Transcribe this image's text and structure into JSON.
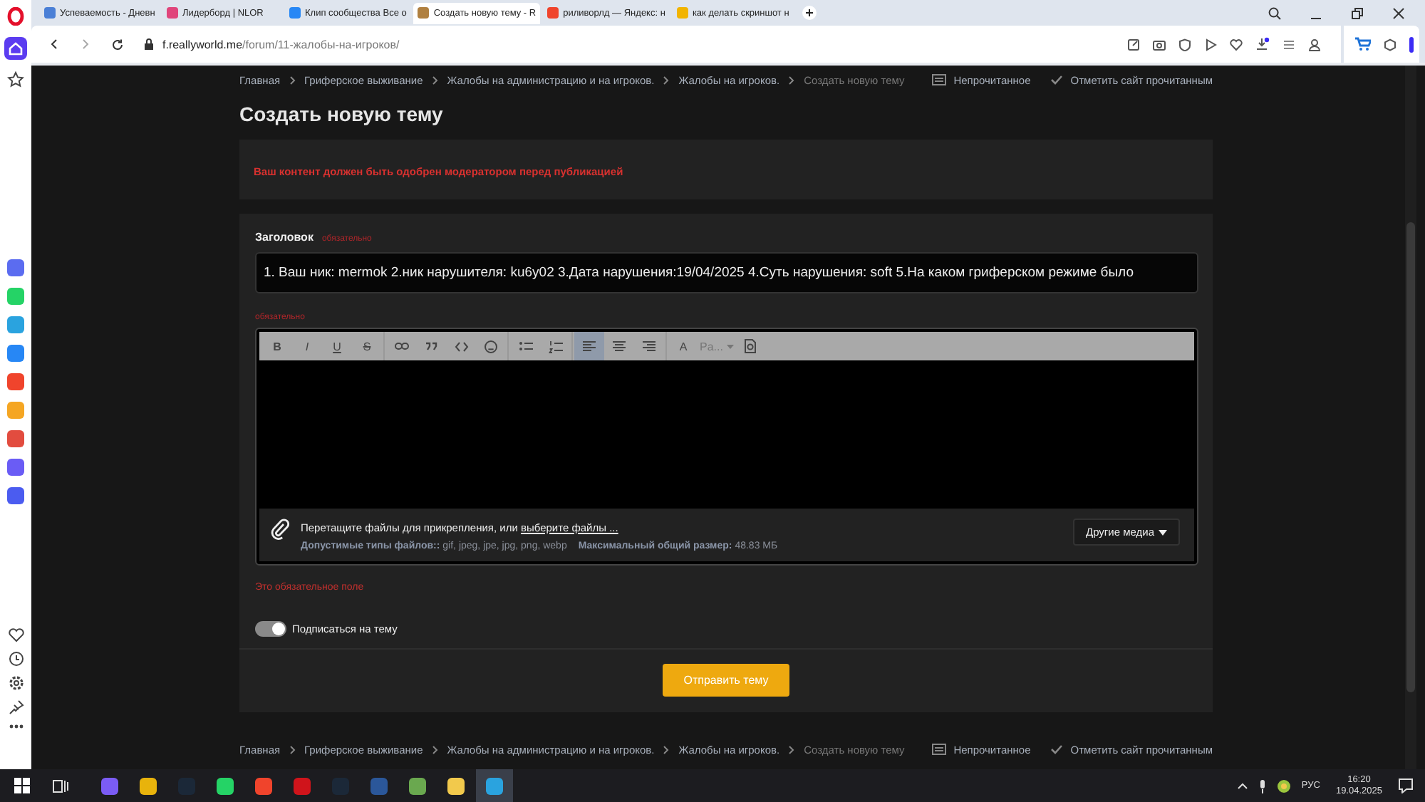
{
  "browser": {
    "tabs": [
      {
        "title": "Успеваемость - Дневн",
        "selected": false,
        "color": "#4a7fd6"
      },
      {
        "title": "Лидерборд | NLOR",
        "selected": false,
        "color": "#e0457b"
      },
      {
        "title": "Клип сообщества Все о",
        "selected": false,
        "color": "#2787f5"
      },
      {
        "title": "Создать новую тему - R",
        "selected": true,
        "color": "#b08040"
      },
      {
        "title": "риливорлд — Яндекс: н",
        "selected": false,
        "color": "#f0442c"
      },
      {
        "title": "как делать скриншот н",
        "selected": false,
        "color": "#f2b400"
      }
    ],
    "address": {
      "host": "f.reallyworld.me",
      "path": "/forum/11-жалобы-на-игроков/"
    },
    "sidebar_apps": [
      {
        "color": "#5b6cf0"
      },
      {
        "color": "#25d366"
      },
      {
        "color": "#2aa3df"
      },
      {
        "color": "#2787f5"
      },
      {
        "color": "#f0442c"
      },
      {
        "color": "#f5a623"
      },
      {
        "color": "#e24c3f"
      },
      {
        "color": "#6a5cf5"
      },
      {
        "color": "#4b5cf0"
      }
    ]
  },
  "breadcrumbs": [
    "Главная",
    "Гриферское выживание",
    "Жалобы на администрацию и на игроков.",
    "Жалобы на игроков.",
    "Создать новую тему"
  ],
  "quick_links": [
    "Непрочитанное",
    "Отметить сайт прочитанным"
  ],
  "footer_breadcrumbs": [
    "Главная",
    "Гриферское выживание",
    "Жалобы на администрацию и на игроков.",
    "Жалобы на игроков.",
    "Создать новую тему"
  ],
  "footer_quick_links": [
    "Непрочитанное",
    "Отметить сайт прочитанным"
  ],
  "page_title": "Создать новую тему",
  "notice": "Ваш контент должен быть одобрен модератором перед публикацией",
  "form": {
    "title_label": "Заголовок",
    "required_hint": "обязательно",
    "title_value": "1. Ваш ник: mermok  2.ник нарушителя: ku6y02  3.Дата нарушения:19/04/2025  4.Суть нарушения: soft  5.На каком гриферском режиме было",
    "body_required_hint": "обязательно",
    "toolbar": [
      {
        "kind": "bold",
        "label": "B",
        "on": false
      },
      {
        "kind": "italic",
        "label": "I",
        "on": false
      },
      {
        "kind": "underline",
        "label": "U",
        "on": false
      },
      {
        "kind": "strike",
        "label": "S",
        "on": false
      },
      {
        "kind": "link",
        "on": false
      },
      {
        "kind": "quote",
        "on": false
      },
      {
        "kind": "code",
        "on": false
      },
      {
        "kind": "emoji",
        "on": false
      },
      {
        "kind": "bullets",
        "on": false
      },
      {
        "kind": "numbers",
        "on": false
      },
      {
        "kind": "align-left",
        "on": true
      },
      {
        "kind": "align-center",
        "on": false
      },
      {
        "kind": "align-right",
        "on": false
      },
      {
        "kind": "font-size",
        "label": "A",
        "on": false
      },
      {
        "kind": "dropdown",
        "label": "Pa...",
        "on": false
      },
      {
        "kind": "preview",
        "on": false
      }
    ],
    "attach_text": "Перетащите файлы для прикрепления, или ",
    "attach_link": "выберите файлы ...",
    "types_label": "Допустимые типы файлов::",
    "types_value": "gif, jpeg, jpe, jpg, png, webp",
    "size_label": "Максимальный общий размер:",
    "size_value": "48.83 МБ",
    "media_button": "Другие медиа",
    "error": "Это обязательное поле",
    "subscribe": {
      "label": "Подписаться на тему",
      "on": true
    },
    "submit": "Отправить тему"
  },
  "taskbar": {
    "apps": [
      {
        "color": "#7b5cf5",
        "selected": false
      },
      {
        "color": "#e8b30c",
        "selected": false
      },
      {
        "color": "#1b2838",
        "selected": false
      },
      {
        "color": "#25d366",
        "selected": false
      },
      {
        "color": "#f0442c",
        "selected": false
      },
      {
        "color": "#d0141b",
        "selected": false
      },
      {
        "color": "#1b2838",
        "selected": false
      },
      {
        "color": "#2b579a",
        "selected": false
      },
      {
        "color": "#6aa84f",
        "selected": false
      },
      {
        "color": "#f2c94c",
        "selected": false
      },
      {
        "color": "#2aa3df",
        "selected": true
      }
    ],
    "language": "РУС",
    "time": "16:20",
    "date": "19.04.2025"
  }
}
